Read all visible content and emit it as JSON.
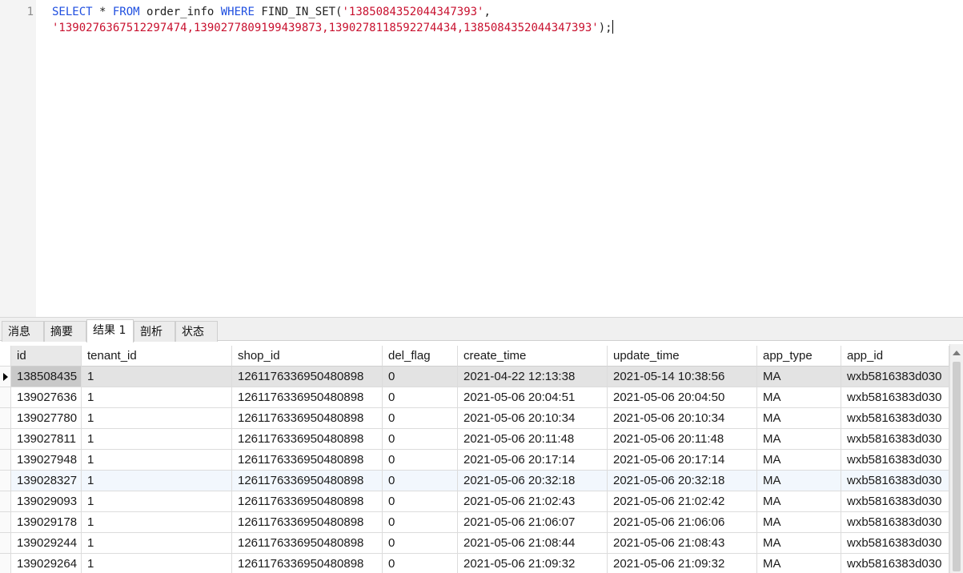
{
  "editor": {
    "line_number": "1",
    "sql": {
      "kw_select": "SELECT",
      "star": " * ",
      "kw_from": "FROM",
      "table": " order_info ",
      "kw_where": "WHERE",
      "func": " FIND_IN_SET(",
      "arg1": "'1385084352044347393'",
      "comma": ",",
      "arg2": "'1390276367512297474,1390277809199439873,1390278118592274434,1385084352044347393'",
      "close": ");"
    }
  },
  "tabs": [
    {
      "label": "消息"
    },
    {
      "label": "摘要"
    },
    {
      "label": "结果 1"
    },
    {
      "label": "剖析"
    },
    {
      "label": "状态"
    }
  ],
  "grid": {
    "columns": [
      "id",
      "tenant_id",
      "shop_id",
      "del_flag",
      "create_time",
      "update_time",
      "app_type",
      "app_id"
    ],
    "rows": [
      [
        "138508435",
        "1",
        "1261176336950480898",
        "0",
        "2021-04-22 12:13:38",
        "2021-05-14 10:38:56",
        "MA",
        "wxb5816383d030"
      ],
      [
        "139027636",
        "1",
        "1261176336950480898",
        "0",
        "2021-05-06 20:04:51",
        "2021-05-06 20:04:50",
        "MA",
        "wxb5816383d030"
      ],
      [
        "139027780",
        "1",
        "1261176336950480898",
        "0",
        "2021-05-06 20:10:34",
        "2021-05-06 20:10:34",
        "MA",
        "wxb5816383d030"
      ],
      [
        "139027811",
        "1",
        "1261176336950480898",
        "0",
        "2021-05-06 20:11:48",
        "2021-05-06 20:11:48",
        "MA",
        "wxb5816383d030"
      ],
      [
        "139027948",
        "1",
        "1261176336950480898",
        "0",
        "2021-05-06 20:17:14",
        "2021-05-06 20:17:14",
        "MA",
        "wxb5816383d030"
      ],
      [
        "139028327",
        "1",
        "1261176336950480898",
        "0",
        "2021-05-06 20:32:18",
        "2021-05-06 20:32:18",
        "MA",
        "wxb5816383d030"
      ],
      [
        "139029093",
        "1",
        "1261176336950480898",
        "0",
        "2021-05-06 21:02:43",
        "2021-05-06 21:02:42",
        "MA",
        "wxb5816383d030"
      ],
      [
        "139029178",
        "1",
        "1261176336950480898",
        "0",
        "2021-05-06 21:06:07",
        "2021-05-06 21:06:06",
        "MA",
        "wxb5816383d030"
      ],
      [
        "139029244",
        "1",
        "1261176336950480898",
        "0",
        "2021-05-06 21:08:44",
        "2021-05-06 21:08:43",
        "MA",
        "wxb5816383d030"
      ],
      [
        "139029264",
        "1",
        "1261176336950480898",
        "0",
        "2021-05-06 21:09:32",
        "2021-05-06 21:09:32",
        "MA",
        "wxb5816383d030"
      ]
    ]
  }
}
